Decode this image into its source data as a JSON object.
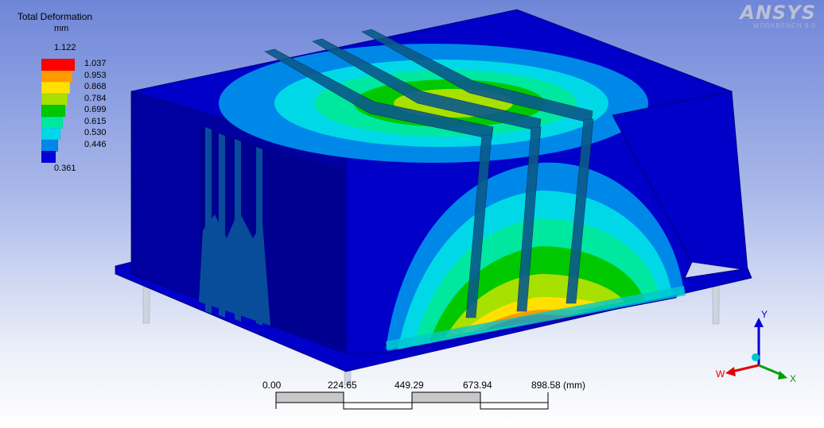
{
  "legend": {
    "title": "Total Deformation",
    "units": "mm",
    "max_value": "1.122",
    "min_value": "0.361",
    "levels": [
      {
        "label": "1.037",
        "color": "#ff0000"
      },
      {
        "label": "0.953",
        "color": "#ff9a00"
      },
      {
        "label": "0.868",
        "color": "#ffe000"
      },
      {
        "label": "0.784",
        "color": "#a8e000"
      },
      {
        "label": "0.699",
        "color": "#00c800"
      },
      {
        "label": "0.615",
        "color": "#00e8a0"
      },
      {
        "label": "0.530",
        "color": "#00d8e8"
      },
      {
        "label": "0.446",
        "color": "#0088e8"
      },
      {
        "label": "",
        "color": "#0000d8"
      }
    ]
  },
  "logo": {
    "main": "ANSYS",
    "sub": "WORKBENCH 9.0"
  },
  "scale_bar": {
    "labels": [
      "0.00",
      "224.65",
      "449.29",
      "673.94",
      "898.58 (mm)"
    ]
  },
  "triad": {
    "x_label": "X",
    "y_label": "Y",
    "z_label": "W"
  },
  "colors": {
    "deep_blue": "#0000c8",
    "dark_blue": "#000090",
    "red": "#ff0000"
  }
}
